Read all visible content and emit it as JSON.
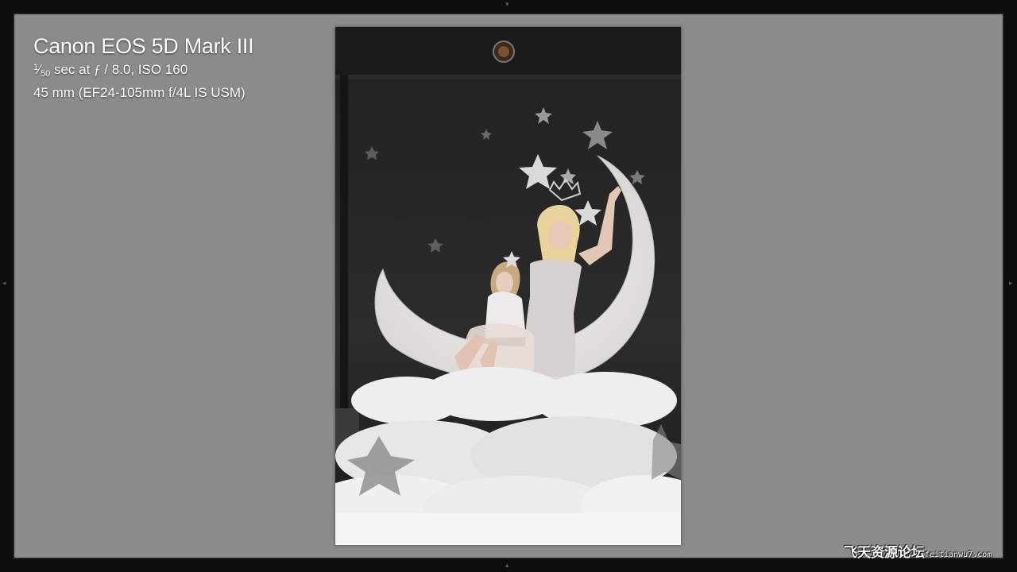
{
  "info": {
    "camera": "Canon EOS 5D Mark III",
    "shutter_numerator": "1",
    "shutter_slash": "⁄",
    "shutter_denominator": "50",
    "exposure_rest": " sec at ",
    "f_symbol": "ƒ",
    "aperture_iso": " / 8.0, ISO 160",
    "lens": "45 mm (EF24-105mm f/4L IS USM)"
  },
  "panel_arrows": {
    "top": "▾",
    "bottom": "▴",
    "left": "◂",
    "right": "▸"
  },
  "watermark": {
    "main": "飞天资源论坛",
    "domain": "feitianwu7.com"
  },
  "colors": {
    "background_gray": "#8b8b8b",
    "frame": "#0d0d0d",
    "text": "#ffffff"
  }
}
